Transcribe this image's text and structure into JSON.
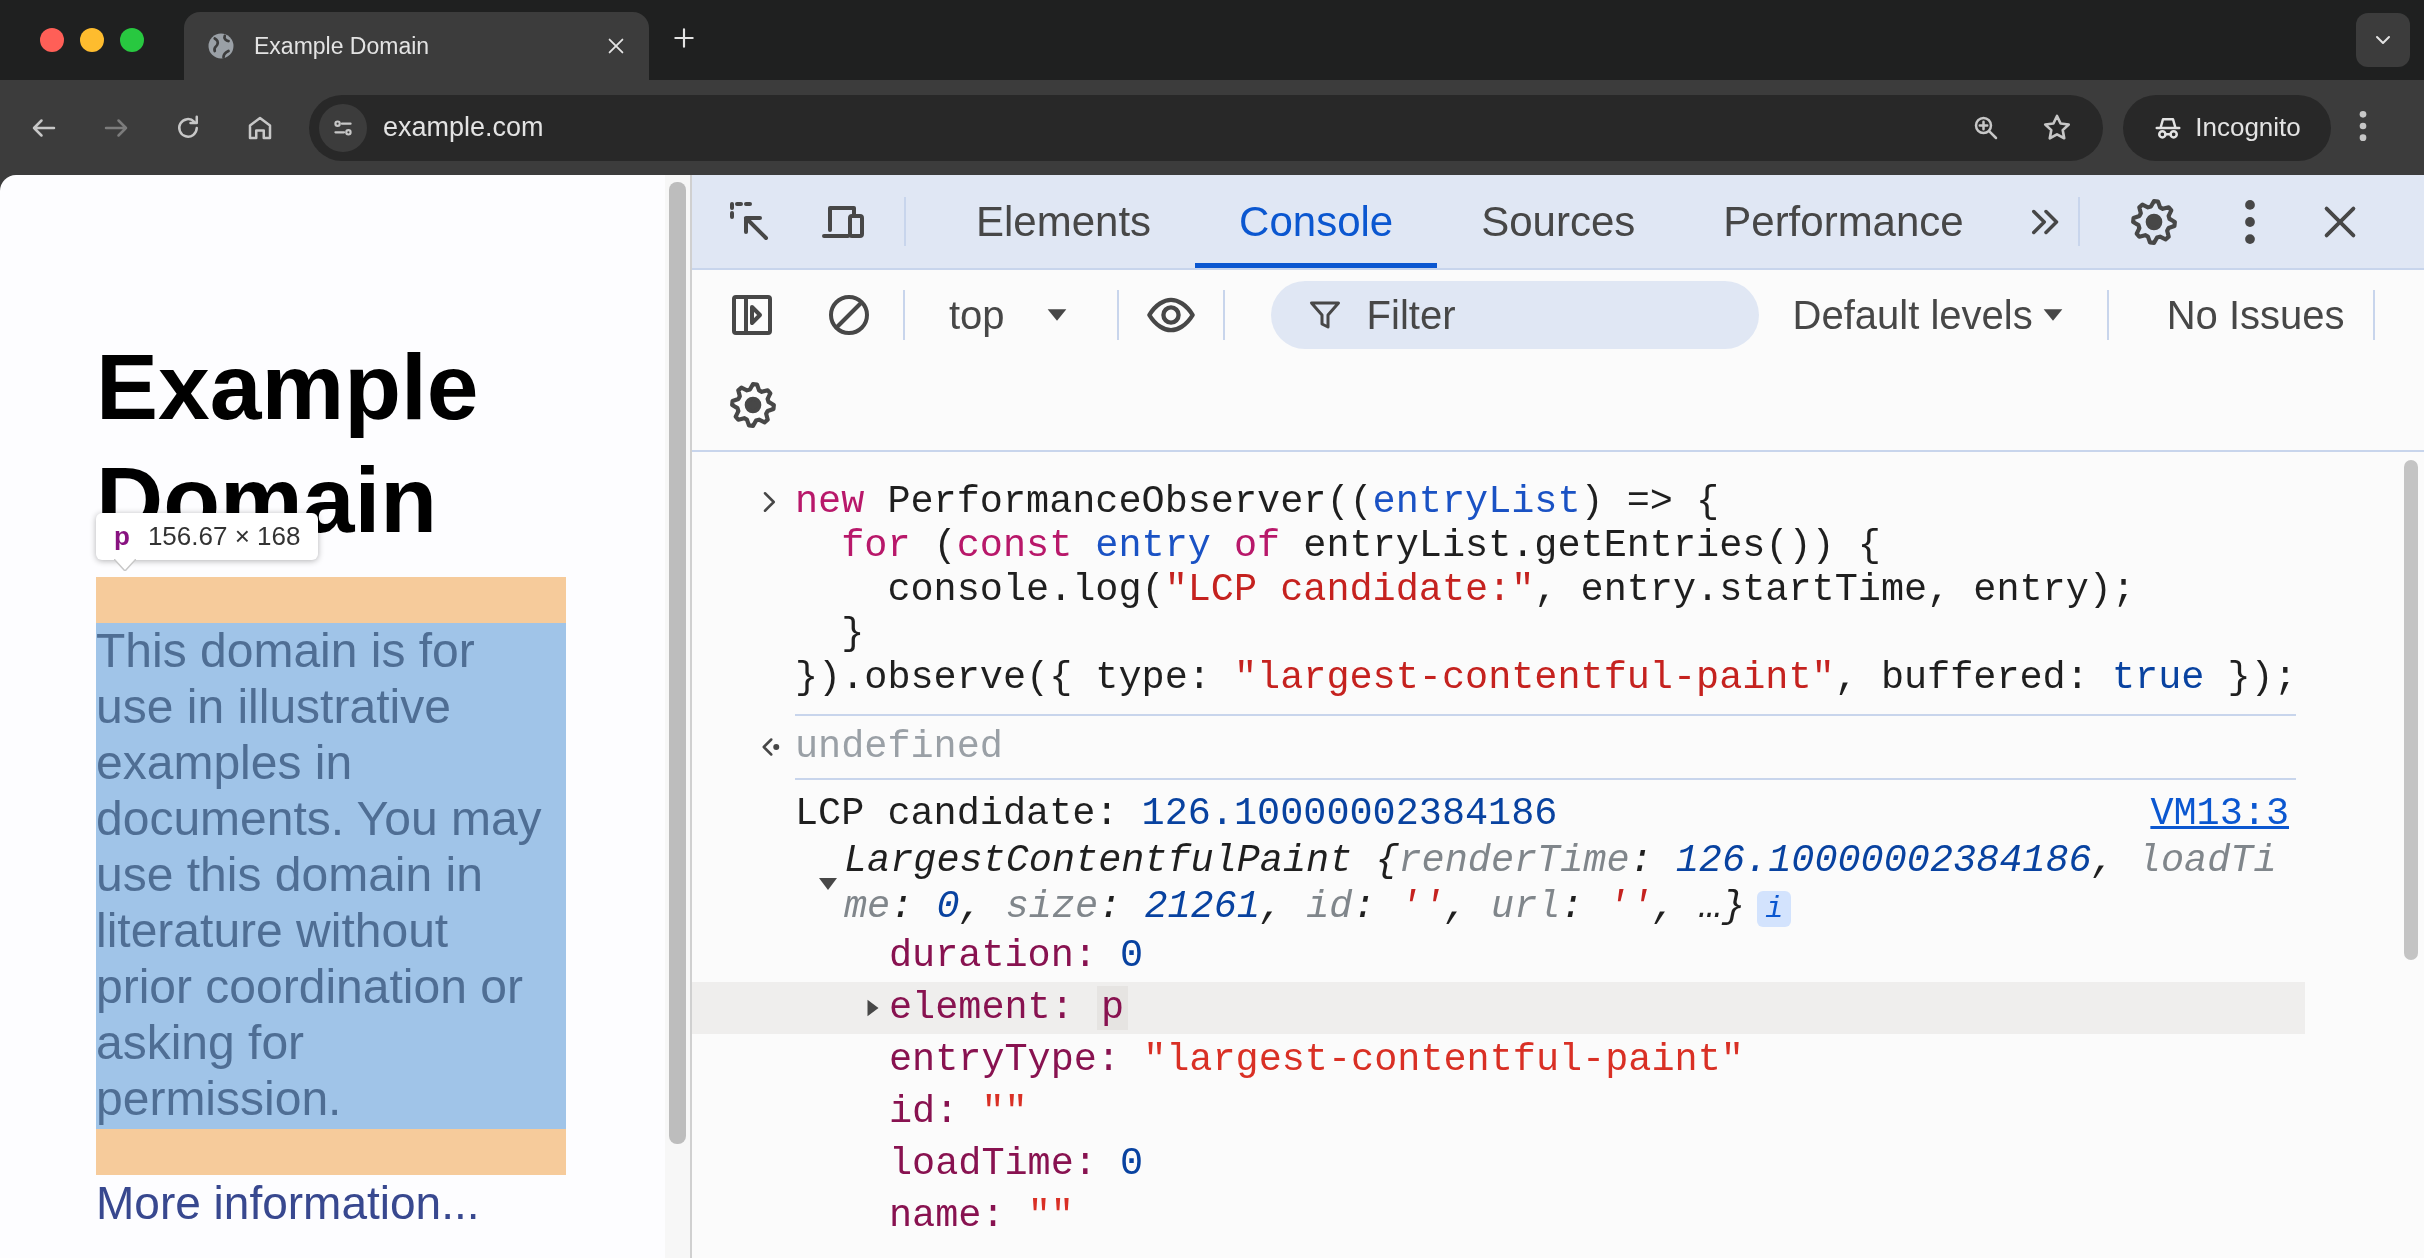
{
  "browser": {
    "tabs": [
      {
        "title": "Example Domain",
        "selected": true
      }
    ],
    "forward_disabled": true,
    "address": "example.com",
    "profile": "Incognito"
  },
  "page": {
    "heading": "Example Domain",
    "inspect_tooltip": {
      "tag": "p",
      "size": "156.67 × 168"
    },
    "paragraph": "This domain is for use in illustrative examples in documents. You may use this domain in literature without prior coordination or asking for permission.",
    "link": "More information..."
  },
  "devtools": {
    "tabs": [
      {
        "label": "Elements",
        "selected": false
      },
      {
        "label": "Console",
        "selected": true
      },
      {
        "label": "Sources",
        "selected": false
      },
      {
        "label": "Performance",
        "selected": false
      }
    ],
    "toolbar": {
      "context": "top",
      "filter_placeholder": "Filter",
      "levels": "Default levels",
      "issues": "No Issues"
    },
    "console": {
      "input": [
        {
          "kind": "outer",
          "segments": [
            {
              "t": "new",
              "kind": "keyword"
            },
            {
              "t": " PerformanceObserver((",
              "kind": "plain"
            },
            {
              "t": "entryList",
              "kind": "variable"
            },
            {
              "t": ") => {",
              "kind": "plain"
            }
          ]
        },
        {
          "kind": "nested",
          "segments": [
            {
              "t": "for",
              "kind": "keyword"
            },
            {
              "t": " (",
              "kind": "plain"
            },
            {
              "t": "const",
              "kind": "keyword"
            },
            {
              "t": " entry",
              "kind": "variable"
            },
            {
              "t": " of",
              "kind": "keyword"
            },
            {
              "t": " entryList.getEntries()) {",
              "kind": "plain"
            }
          ]
        },
        {
          "kind": "inner",
          "segments": [
            {
              "t": "console.log(",
              "kind": "plain"
            },
            {
              "t": "\"LCP candidate:\"",
              "kind": "string"
            },
            {
              "t": ", entry.startTime, entry);",
              "kind": "plain"
            }
          ]
        },
        {
          "kind": "nested",
          "segments": [
            {
              "t": "}",
              "kind": "plain"
            }
          ]
        },
        {
          "kind": "outer",
          "segments": [
            {
              "t": "}).observe({ type: ",
              "kind": "plain"
            },
            {
              "t": "\"largest-contentful-paint\"",
              "kind": "string"
            },
            {
              "t": ", buffered: ",
              "kind": "plain"
            },
            {
              "t": "true",
              "kind": "number"
            },
            {
              "t": " });",
              "kind": "plain"
            }
          ]
        }
      ],
      "result": "undefined",
      "log": {
        "segments": [
          {
            "t": "LCP candidate: ",
            "kind": "plain"
          },
          {
            "t": "126.10000002384186",
            "kind": "number"
          }
        ],
        "source": "VM13:3"
      },
      "object": {
        "expanded": true,
        "preview": [
          {
            "t": "LargestContentfulPaint {",
            "kind": "plain"
          },
          {
            "t": "renderTime",
            "kind": "key"
          },
          {
            "t": ": ",
            "kind": "plain"
          },
          {
            "t": "126.10000002384186",
            "kind": "number"
          },
          {
            "t": ", ",
            "kind": "plain"
          },
          {
            "t": "loadTime",
            "kind": "key"
          },
          {
            "t": ": ",
            "kind": "plain"
          },
          {
            "t": "0",
            "kind": "number"
          },
          {
            "t": ", ",
            "kind": "plain"
          },
          {
            "t": "size",
            "kind": "key"
          },
          {
            "t": ": ",
            "kind": "plain"
          },
          {
            "t": "21261",
            "kind": "number"
          },
          {
            "t": ", ",
            "kind": "plain"
          },
          {
            "t": "id",
            "kind": "key"
          },
          {
            "t": ": ",
            "kind": "plain"
          },
          {
            "t": "''",
            "kind": "string"
          },
          {
            "t": ", ",
            "kind": "plain"
          },
          {
            "t": "url",
            "kind": "key"
          },
          {
            "t": ": ",
            "kind": "plain"
          },
          {
            "t": "''",
            "kind": "string"
          },
          {
            "t": ", …}",
            "kind": "plain"
          }
        ],
        "badge": "i",
        "properties": [
          {
            "key": "duration:",
            "value": "0",
            "kind": "number",
            "highlighted": false
          },
          {
            "key": "element:",
            "value": "p",
            "kind": "node",
            "expanded": false,
            "highlighted": true
          },
          {
            "key": "entryType:",
            "value": "\"largest-contentful-paint\"",
            "kind": "string",
            "highlighted": false
          },
          {
            "key": "id:",
            "value": "\"\"",
            "kind": "string",
            "highlighted": false
          },
          {
            "key": "loadTime:",
            "value": "0",
            "kind": "number",
            "highlighted": false
          },
          {
            "key": "name:",
            "value": "\"\"",
            "kind": "string",
            "highlighted": false
          }
        ]
      }
    }
  }
}
